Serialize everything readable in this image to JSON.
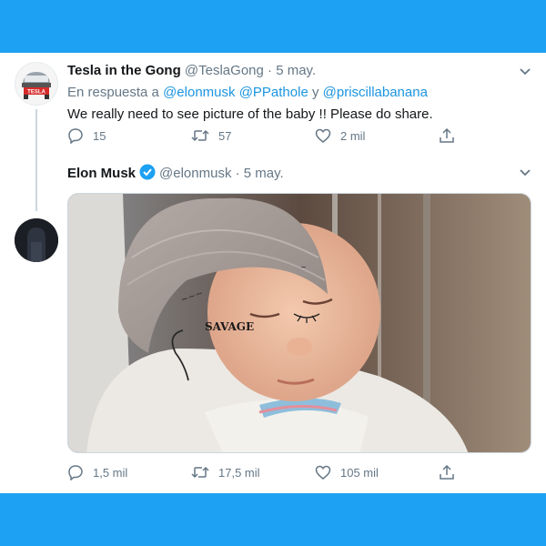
{
  "tweet1": {
    "name": "Tesla in the Gong",
    "handle": "@TeslaGong",
    "date": "· 5 may.",
    "reply_prefix": "En respuesta a",
    "mention1": "@elonmusk",
    "mention2": "@PPathole",
    "reply_and": "y",
    "mention3": "@priscillabanana",
    "text": "We really need to see picture of the baby !! Please do share.",
    "replies": "15",
    "retweets": "57",
    "likes": "2 mil",
    "avatar_logo": "TESLA"
  },
  "tweet2": {
    "name": "Elon Musk",
    "handle": "@elonmusk",
    "date": "· 5 may.",
    "replies": "1,5 mil",
    "retweets": "17,5 mil",
    "likes": "105 mil",
    "photo_text": "SAVAGE"
  },
  "colors": {
    "background": "#1da1f2",
    "link": "#1b95e0",
    "muted": "#657786",
    "verified": "#1da1f2"
  },
  "icons": [
    "reply-icon",
    "retweet-icon",
    "like-icon",
    "share-icon",
    "chevron-down-icon",
    "verified-icon"
  ]
}
